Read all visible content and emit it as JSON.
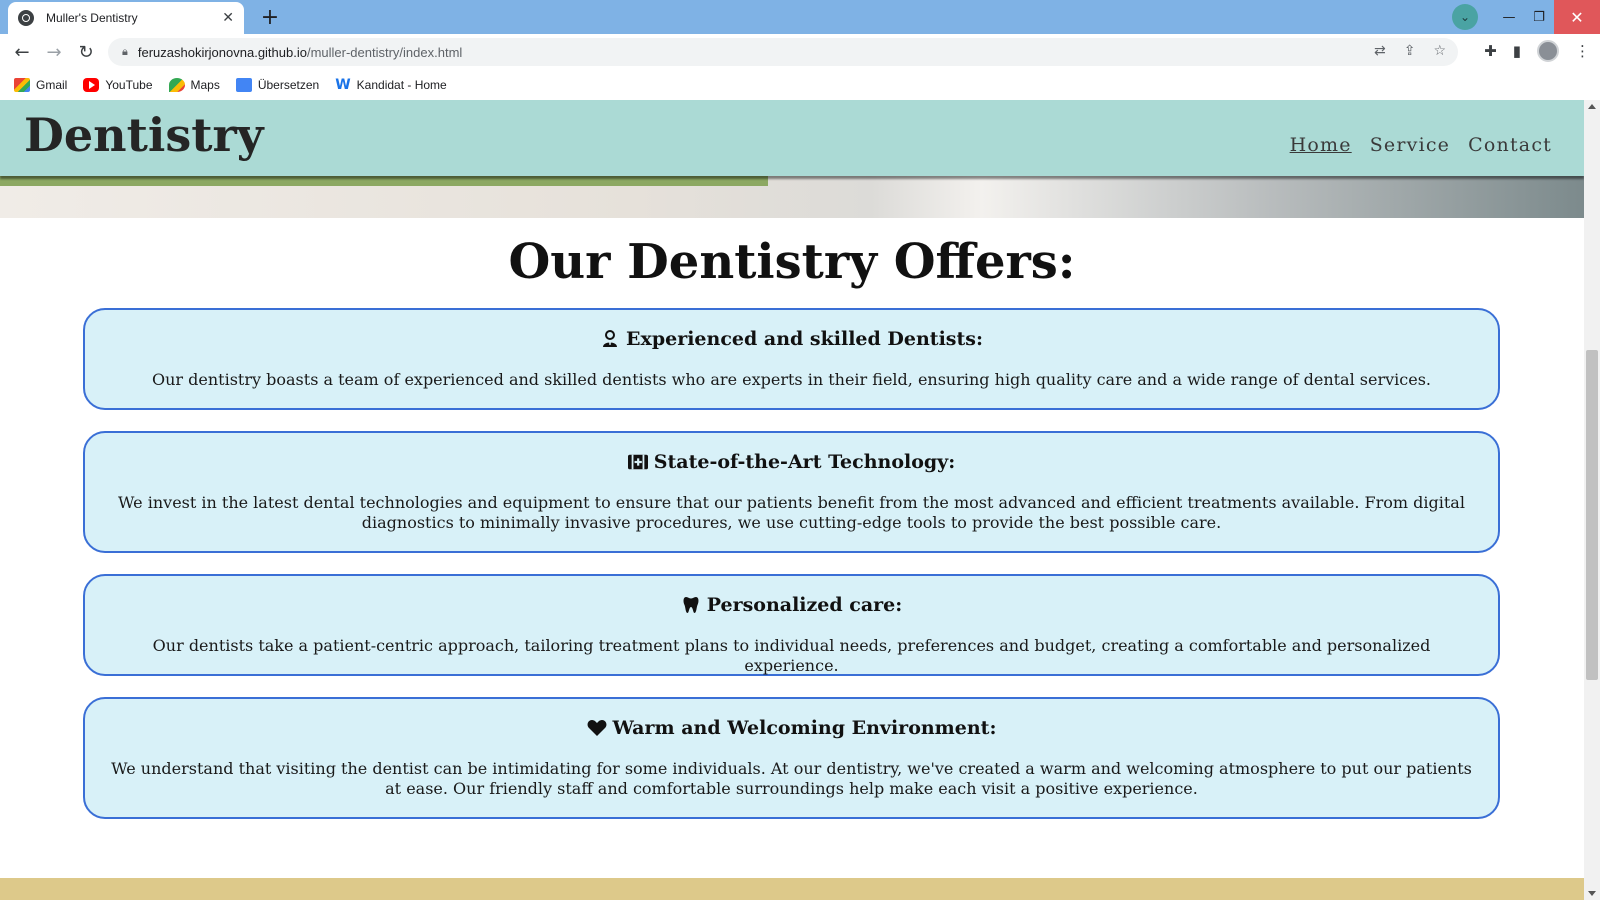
{
  "browser": {
    "tab_title": "Muller's Dentistry",
    "tab_close": "✕",
    "new_tab": "+",
    "url_host": "feruzashokirjonovna.github.io",
    "url_path": "/muller-dentistry/index.html",
    "bookmarks": [
      {
        "label": "Gmail",
        "icon": "gmail-icon"
      },
      {
        "label": "YouTube",
        "icon": "youtube-icon"
      },
      {
        "label": "Maps",
        "icon": "maps-icon"
      },
      {
        "label": "Übersetzen",
        "icon": "translate-icon"
      },
      {
        "label": "Kandidat - Home",
        "icon": "w-icon"
      }
    ]
  },
  "site": {
    "logo": "Dentistry",
    "nav": [
      "Home",
      "Service",
      "Contact"
    ],
    "section_title": "Our Dentistry Offers:",
    "offers": [
      {
        "icon": "user-tie-icon",
        "title": "Experienced and skilled Dentists:",
        "text": "Our dentistry boasts a team of experienced and skilled dentists who are experts in their field, ensuring high quality care and a wide range of dental services."
      },
      {
        "icon": "medical-kit-icon",
        "title": "State-of-the-Art Technology:",
        "text": "We invest in the latest dental technologies and equipment to ensure that our patients benefit from the most advanced and efficient treatments available. From digital diagnostics to minimally invasive procedures, we use cutting-edge tools to provide the best possible care."
      },
      {
        "icon": "tooth-icon",
        "title": "Personalized care:",
        "text": "Our dentists take a patient-centric approach, tailoring treatment plans to individual needs, preferences and budget, creating a comfortable and personalized experience."
      },
      {
        "icon": "heart-icon",
        "title": "Warm and Welcoming Environment:",
        "text": "We understand that visiting the dentist can be intimidating for some individuals. At our dentistry, we've created a warm and welcoming atmosphere to put our patients at ease. Our friendly staff and comfortable surroundings help make each visit a positive experience."
      }
    ]
  },
  "colors": {
    "header_bg": "#abdad5",
    "card_bg": "#d8f1f8",
    "card_border": "#3a6fd6",
    "accent_bar": "#8ca862",
    "footer_band": "#ddc98a"
  }
}
